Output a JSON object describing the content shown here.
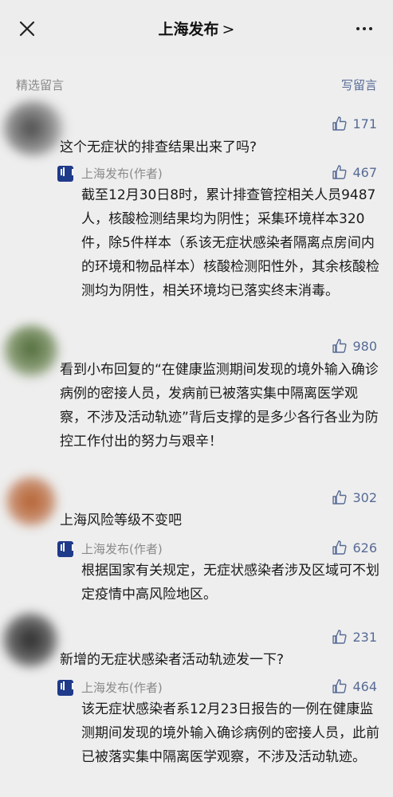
{
  "header": {
    "title": "上海发布",
    "chevron": ">"
  },
  "section": {
    "label": "精选留言",
    "write_link": "写留言"
  },
  "comments": [
    {
      "likes": "171",
      "text": "这个无症状的排查结果出来了吗?",
      "reply": {
        "author": "上海发布(作者)",
        "likes": "467",
        "text": "截至12月30日8时，累计排查管控相关人员9487人，核酸检测结果均为阴性；采集环境样本320件，除5件样本（系该无症状感染者隔离点房间内的环境和物品样本）核酸检测阳性外，其余核酸检测均为阴性，相关环境均已落实终末消毒。"
      }
    },
    {
      "likes": "980",
      "text": "看到小布回复的“在健康监测期间发现的境外输入确诊病例的密接人员，发病前已被落实集中隔离医学观察，不涉及活动轨迹”背后支撑的是多少各行各业为防控工作付出的努力与艰辛！"
    },
    {
      "likes": "302",
      "text": "上海风险等级不变吧",
      "reply": {
        "author": "上海发布(作者)",
        "likes": "626",
        "text": "根据国家有关规定，无症状感染者涉及区域可不划定疫情中高风险地区。"
      }
    },
    {
      "likes": "231",
      "text": "新增的无症状感染者活动轨迹发一下?",
      "reply": {
        "author": "上海发布(作者)",
        "likes": "464",
        "text": "该无症状感染者系12月23日报告的一例在健康监测期间发现的境外输入确诊病例的密接人员，此前已被落实集中隔离医学观察，不涉及活动轨迹。"
      }
    }
  ]
}
